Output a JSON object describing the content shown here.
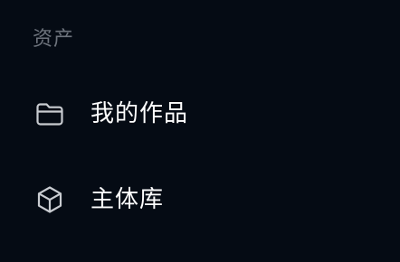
{
  "colors": {
    "background": "#050b14",
    "section_label": "#6d737c",
    "item_label": "#ffffff",
    "icon_stroke": "#c9ccd1"
  },
  "section": {
    "label": "资产"
  },
  "nav": {
    "items": [
      {
        "label": "我的作品",
        "icon": "folder-icon"
      },
      {
        "label": "主体库",
        "icon": "cube-icon"
      }
    ]
  }
}
